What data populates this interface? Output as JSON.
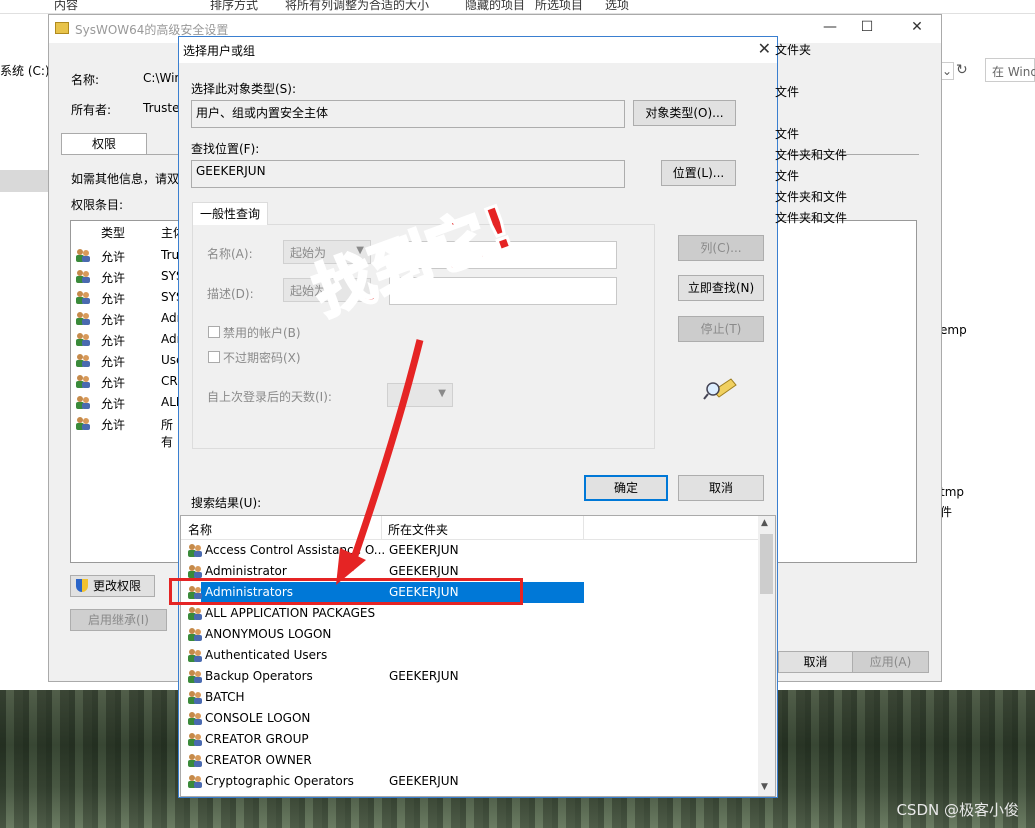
{
  "explorer": {
    "ribbon": [
      "内容",
      "排序方式",
      "将所有列调整为合适的大小",
      "隐藏的项目",
      "所选项目",
      "选项"
    ],
    "drive_label": "系统 (C:)",
    "search_placeholder": "在 Wind",
    "right_texts": [
      "emp",
      "tmp",
      "件"
    ]
  },
  "adv_window": {
    "title": "SysWOW64的高级安全设置",
    "name_label": "名称:",
    "name_value": "C:\\Win",
    "owner_label": "所有者:",
    "owner_value": "Truste",
    "tab": "权限",
    "info_text": "如需其他信息，请双",
    "entries_label": "权限条目:",
    "col_type": "类型",
    "col_principal": "主体",
    "rows": [
      {
        "type": "允许",
        "name": "Tru",
        "applies": "文件夹"
      },
      {
        "type": "允许",
        "name": "SYS",
        "applies": ""
      },
      {
        "type": "允许",
        "name": "SYS",
        "applies": "文件"
      },
      {
        "type": "允许",
        "name": "Adı",
        "applies": ""
      },
      {
        "type": "允许",
        "name": "Adı",
        "applies": "文件"
      },
      {
        "type": "允许",
        "name": "Use",
        "applies": "文件夹和文件"
      },
      {
        "type": "允许",
        "name": "CRI",
        "applies": "文件"
      },
      {
        "type": "允许",
        "name": "ALL",
        "applies": "文件夹和文件"
      },
      {
        "type": "允许",
        "name": "所有",
        "applies": "文件夹和文件"
      }
    ],
    "change_perms": "更改权限",
    "enable_inherit": "启用继承(I)",
    "cancel": "取消",
    "apply": "应用(A)"
  },
  "dialog": {
    "title": "选择用户或组",
    "object_type_label": "选择此对象类型(S):",
    "object_type_value": "用户、组或内置安全主体",
    "object_type_btn": "对象类型(O)...",
    "location_label": "查找位置(F):",
    "location_value": "GEEKERJUN",
    "location_btn": "位置(L)...",
    "common_query_tab": "一般性查询",
    "name_label": "名称(A):",
    "name_combo": "起始为",
    "desc_label": "描述(D):",
    "desc_combo": "起始为",
    "disabled_accounts": "禁用的帐户(B)",
    "non_expiring": "不过期密码(X)",
    "days_since": "自上次登录后的天数(I):",
    "columns_btn": "列(C)...",
    "find_now_btn": "立即查找(N)",
    "stop_btn": "停止(T)",
    "ok_btn": "确定",
    "cancel_btn": "取消",
    "results_label": "搜索结果(U):",
    "results_col_name": "名称",
    "results_col_folder": "所在文件夹",
    "results": [
      {
        "name": "Access Control Assistance O...",
        "folder": "GEEKERJUN"
      },
      {
        "name": "Administrator",
        "folder": "GEEKERJUN"
      },
      {
        "name": "Administrators",
        "folder": "GEEKERJUN",
        "selected": true
      },
      {
        "name": "ALL APPLICATION PACKAGES",
        "folder": ""
      },
      {
        "name": "ANONYMOUS LOGON",
        "folder": ""
      },
      {
        "name": "Authenticated Users",
        "folder": ""
      },
      {
        "name": "Backup Operators",
        "folder": "GEEKERJUN"
      },
      {
        "name": "BATCH",
        "folder": ""
      },
      {
        "name": "CONSOLE LOGON",
        "folder": ""
      },
      {
        "name": "CREATOR GROUP",
        "folder": ""
      },
      {
        "name": "CREATOR OWNER",
        "folder": ""
      },
      {
        "name": "Cryptographic Operators",
        "folder": "GEEKERJUN"
      }
    ]
  },
  "annotation": {
    "text": "找到它!",
    "color": "#e52424"
  },
  "watermark": "CSDN @极客小俊",
  "colors": {
    "selection": "#0078d7",
    "accent_border": "#3a7fd0",
    "annotation": "#e52424"
  }
}
